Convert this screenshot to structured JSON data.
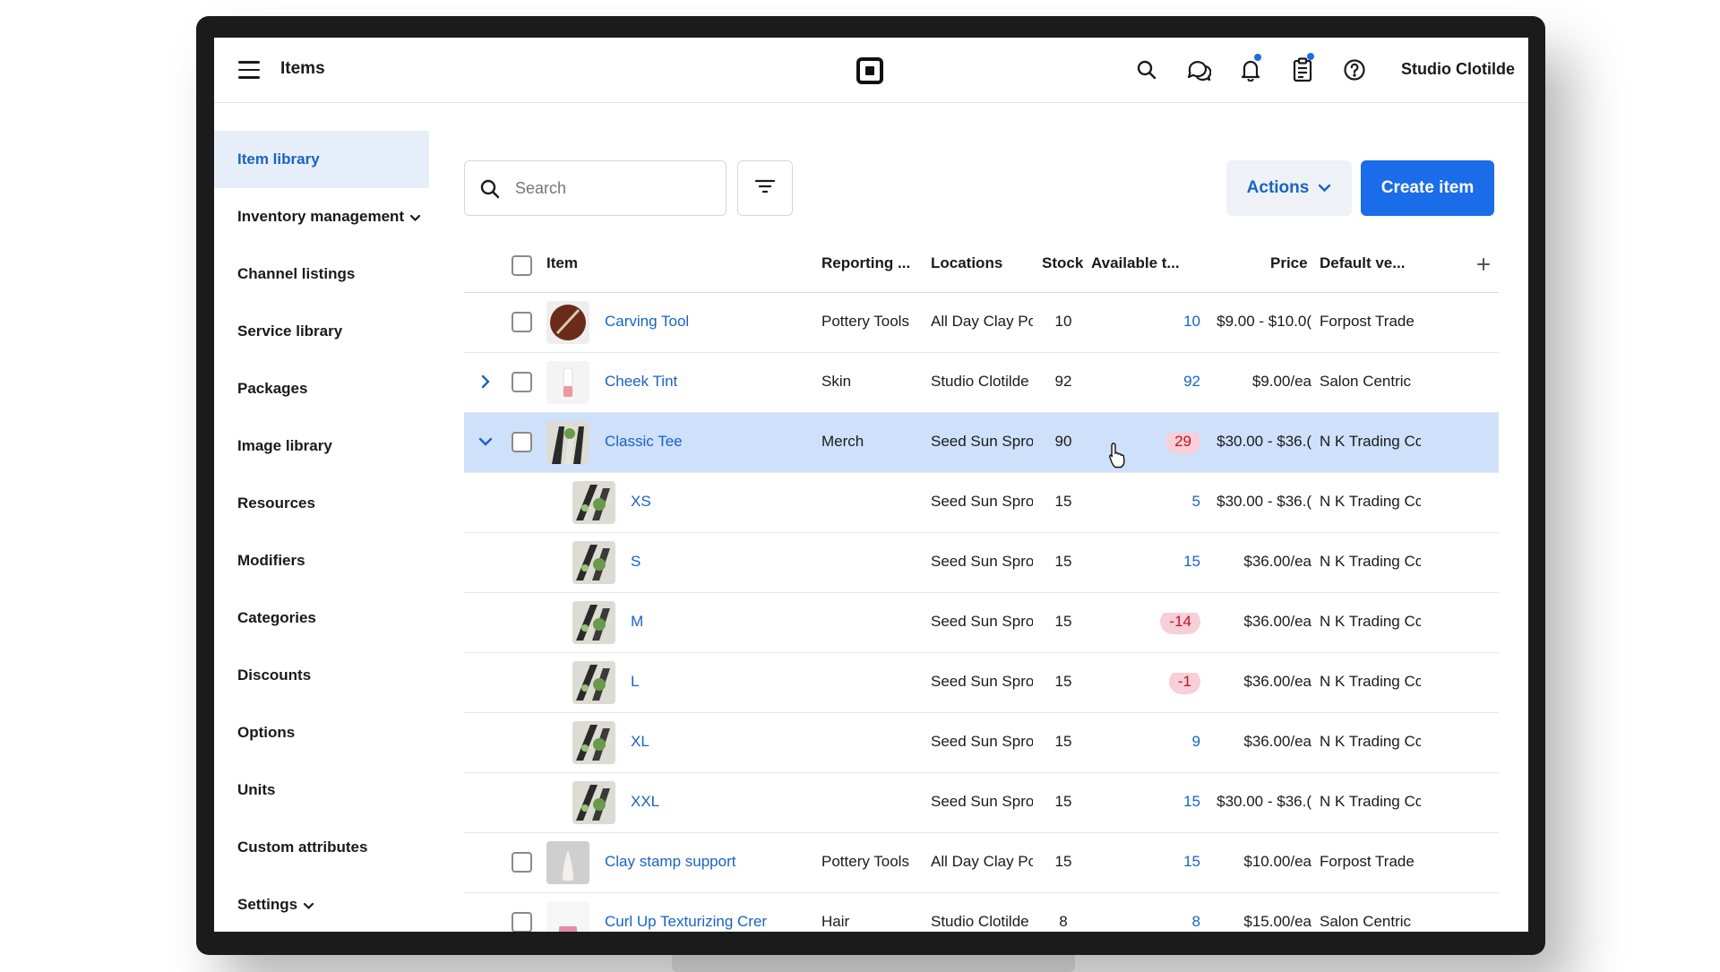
{
  "topbar": {
    "title": "Items",
    "account": "Studio Clotilde"
  },
  "icons": {
    "menu": "hamburger-menu-icon",
    "logo": "square-logo-icon",
    "search": "search-icon",
    "messages": "chat-bubbles-icon",
    "notifications": "bell-icon",
    "tasks": "clipboard-icon",
    "help": "help-circle-icon"
  },
  "sidebar": {
    "items": [
      {
        "label": "Item library",
        "active": true
      },
      {
        "label": "Inventory management",
        "dropdown": true
      },
      {
        "label": "Channel listings"
      },
      {
        "label": "Service library"
      },
      {
        "label": "Packages"
      },
      {
        "label": "Image library"
      },
      {
        "label": "Resources"
      },
      {
        "label": "Modifiers"
      },
      {
        "label": "Categories"
      },
      {
        "label": "Discounts"
      },
      {
        "label": "Options"
      },
      {
        "label": "Units"
      },
      {
        "label": "Custom attributes"
      },
      {
        "label": "Settings",
        "dropdown": true
      }
    ]
  },
  "toolbar": {
    "search_placeholder": "Search",
    "actions_label": "Actions",
    "create_label": "Create item"
  },
  "colors": {
    "accent": "#1a6ce8",
    "link": "#1963c4",
    "selected_row": "#cfe0fb",
    "negative_badge_bg": "#f7cfd6"
  },
  "table": {
    "columns": {
      "item": "Item",
      "reporting": "Reporting ...",
      "locations": "Locations",
      "stock": "Stock",
      "available": "Available t...",
      "price": "Price",
      "vendor": "Default ve..."
    },
    "rows": [
      {
        "name": "Carving Tool",
        "reporting": "Pottery Tools",
        "location": "All Day Clay Pc",
        "stock": "10",
        "available": "10",
        "price": "$9.00 - $10.0(",
        "vendor": "Forpost Trade"
      },
      {
        "name": "Cheek Tint",
        "reporting": "Skin",
        "location": "Studio Clotilde",
        "stock": "92",
        "available": "92",
        "price": "$9.00/ea",
        "vendor": "Salon Centric"
      },
      {
        "name": "Classic Tee",
        "reporting": "Merch",
        "location": "Seed Sun Spro",
        "stock": "90",
        "available": "29",
        "price": "$30.00 - $36.(",
        "vendor": "N K Trading Cc"
      },
      {
        "name": "XS",
        "reporting": "",
        "location": "Seed Sun Spro",
        "stock": "15",
        "available": "5",
        "price": "$30.00 - $36.(",
        "vendor": "N K Trading Cc"
      },
      {
        "name": "S",
        "reporting": "",
        "location": "Seed Sun Spro",
        "stock": "15",
        "available": "15",
        "price": "$36.00/ea",
        "vendor": "N K Trading Cc"
      },
      {
        "name": "M",
        "reporting": "",
        "location": "Seed Sun Spro",
        "stock": "15",
        "available": "-14",
        "price": "$36.00/ea",
        "vendor": "N K Trading Cc"
      },
      {
        "name": "L",
        "reporting": "",
        "location": "Seed Sun Spro",
        "stock": "15",
        "available": "-1",
        "price": "$36.00/ea",
        "vendor": "N K Trading Cc"
      },
      {
        "name": "XL",
        "reporting": "",
        "location": "Seed Sun Spro",
        "stock": "15",
        "available": "9",
        "price": "$36.00/ea",
        "vendor": "N K Trading Cc"
      },
      {
        "name": "XXL",
        "reporting": "",
        "location": "Seed Sun Spro",
        "stock": "15",
        "available": "15",
        "price": "$30.00 - $36.(",
        "vendor": "N K Trading Cc"
      },
      {
        "name": "Clay stamp support",
        "reporting": "Pottery Tools",
        "location": "All Day Clay Pc",
        "stock": "15",
        "available": "15",
        "price": "$10.00/ea",
        "vendor": "Forpost Trade"
      },
      {
        "name": "Curl Up Texturizing Crer",
        "reporting": "Hair",
        "location": "Studio Clotilde",
        "stock": "8",
        "available": "8",
        "price": "$15.00/ea",
        "vendor": "Salon Centric"
      }
    ]
  }
}
